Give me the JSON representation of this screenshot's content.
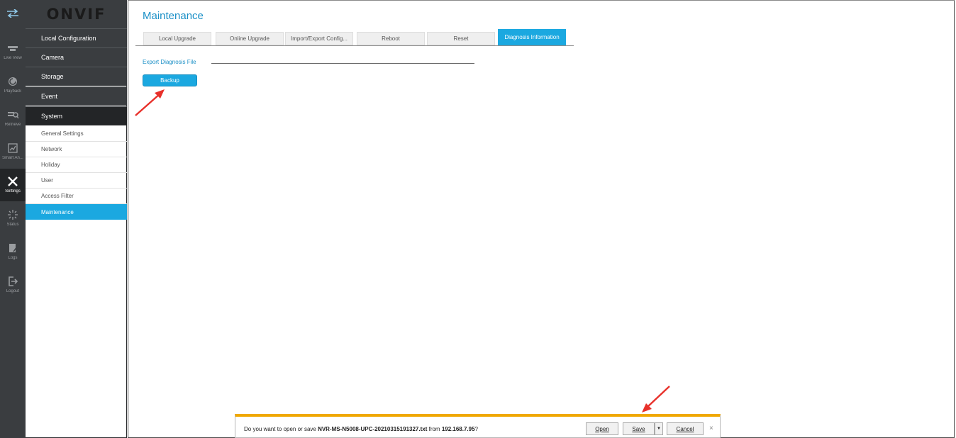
{
  "rail": {
    "items": [
      {
        "label": "Live View",
        "icon": "live-view-icon"
      },
      {
        "label": "Playback",
        "icon": "playback-icon"
      },
      {
        "label": "Retrieve",
        "icon": "retrieve-icon"
      },
      {
        "label": "Smart An...",
        "icon": "smart-analysis-icon"
      },
      {
        "label": "Settings",
        "icon": "settings-icon",
        "active": true
      },
      {
        "label": "Status",
        "icon": "status-icon"
      },
      {
        "label": "Logs",
        "icon": "logs-icon"
      },
      {
        "label": "Logout",
        "icon": "logout-icon"
      }
    ]
  },
  "menu": {
    "logo": "ONVIF",
    "sections": [
      "Local Configuration",
      "Camera",
      "Storage",
      "Event",
      "System"
    ],
    "system_items": [
      "General Settings",
      "Network",
      "Holiday",
      "User",
      "Access Filter",
      "Maintenance"
    ]
  },
  "main": {
    "title": "Maintenance",
    "tabs": [
      "Local Upgrade",
      "Online Upgrade",
      "Import/Export Config...",
      "Reboot",
      "Reset",
      "Diagnosis Information"
    ],
    "active_tab": "Diagnosis Information",
    "section_label": "Export Diagnosis File",
    "backup_label": "Backup"
  },
  "download_bar": {
    "prefix": "Do you want to open or save ",
    "filename": "NVR-MS-N5008-UPC-20210315191327.txt",
    "middle": " from ",
    "host": "192.168.7.95",
    "suffix": "?",
    "open_label": "Open",
    "save_label": "Save",
    "dropdown_glyph": "▼",
    "cancel_label": "Cancel",
    "close_glyph": "×"
  },
  "colors": {
    "accent": "#1ba8e0",
    "rail_bg": "#3a3d40",
    "active_bg": "#232527",
    "notification_bar": "#f0a800",
    "annotation_arrow": "#e8302a"
  }
}
